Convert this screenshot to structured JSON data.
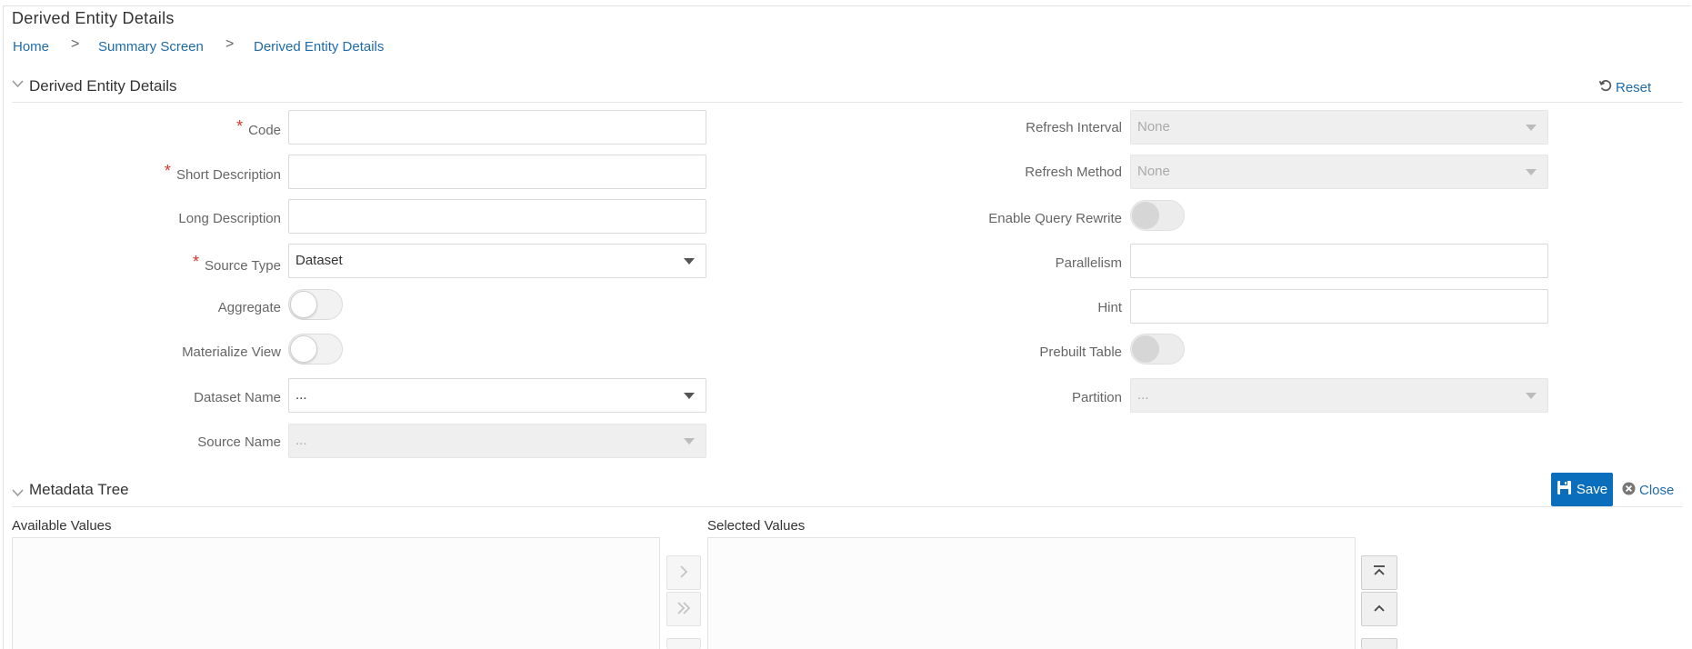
{
  "page": {
    "title": "Derived Entity Details"
  },
  "breadcrumb": {
    "items": [
      "Home",
      "Summary Screen",
      "Derived Entity Details"
    ],
    "separator": ">"
  },
  "details_section": {
    "title": "Derived Entity Details",
    "reset_label": "Reset"
  },
  "form_left": {
    "code": {
      "label": "Code",
      "required": "*",
      "value": ""
    },
    "short_description": {
      "label": "Short Description",
      "required": "*",
      "value": ""
    },
    "long_description": {
      "label": "Long Description",
      "value": ""
    },
    "source_type": {
      "label": "Source Type",
      "required": "*",
      "value": "Dataset"
    },
    "aggregate": {
      "label": "Aggregate",
      "state": "off"
    },
    "materialize_view": {
      "label": "Materialize View",
      "state": "off"
    },
    "dataset_name": {
      "label": "Dataset Name",
      "value": "..."
    },
    "source_name": {
      "label": "Source Name",
      "value": "..."
    }
  },
  "form_right": {
    "refresh_interval": {
      "label": "Refresh Interval",
      "value": "None"
    },
    "refresh_method": {
      "label": "Refresh Method",
      "value": "None"
    },
    "enable_query_rewrite": {
      "label": "Enable Query Rewrite",
      "state": "off"
    },
    "parallelism": {
      "label": "Parallelism",
      "value": ""
    },
    "hint": {
      "label": "Hint",
      "value": ""
    },
    "prebuilt_table": {
      "label": "Prebuilt Table",
      "state": "off"
    },
    "partition": {
      "label": "Partition",
      "value": "..."
    }
  },
  "metadata_section": {
    "title": "Metadata Tree",
    "save_label": "Save",
    "close_label": "Close",
    "available_label": "Available Values",
    "selected_label": "Selected Values"
  },
  "colors": {
    "link": "#1f6ba8",
    "primary_button": "#0a6ebd",
    "required": "#d9342b"
  }
}
